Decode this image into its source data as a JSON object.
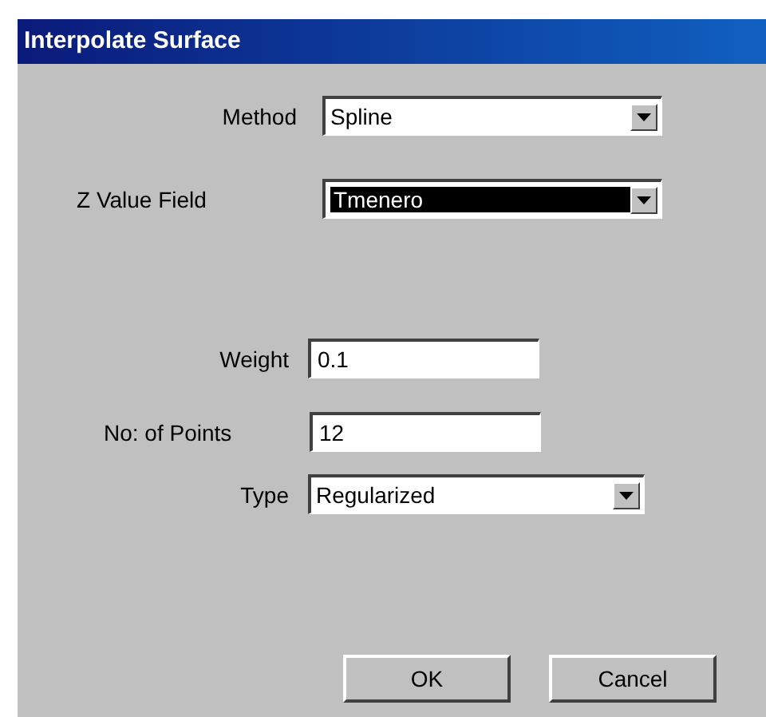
{
  "window": {
    "title": "Interpolate Surface"
  },
  "fields": [
    {
      "label": "Method",
      "kind": "dropdown",
      "value": "Spline",
      "focused": false
    },
    {
      "label": "Z Value Field",
      "kind": "dropdown",
      "value": "Tmenero",
      "focused": true
    },
    {
      "label": "Weight",
      "kind": "text",
      "value": "0.1",
      "focused": false
    },
    {
      "label": "No: of Points",
      "kind": "text",
      "value": "12",
      "focused": false
    },
    {
      "label": "Type",
      "kind": "dropdown",
      "value": "Regularized",
      "focused": false
    }
  ],
  "buttons": [
    "OK",
    "Cancel"
  ]
}
